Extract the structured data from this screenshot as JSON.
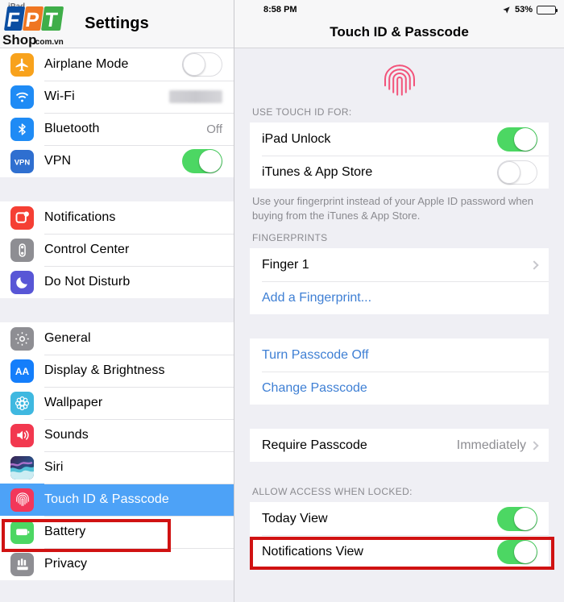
{
  "branding": {
    "logo_text_f": "F",
    "logo_text_p": "P",
    "logo_text_t": "T",
    "logo_shop": "Shop",
    "logo_domain": ".com.vn"
  },
  "sidebar": {
    "title": "Settings",
    "status_left": "iPad",
    "groups": [
      {
        "items": [
          {
            "label": "Airplane Mode",
            "icon": "airplane-icon",
            "icon_color": "#f8a21c",
            "control": "toggle",
            "value": "off"
          },
          {
            "label": "Wi-Fi",
            "icon": "wifi-icon",
            "icon_color": "#1f8bf5",
            "control": "blurred",
            "value": ""
          },
          {
            "label": "Bluetooth",
            "icon": "bluetooth-icon",
            "icon_color": "#1f8bf5",
            "control": "text",
            "value": "Off"
          },
          {
            "label": "VPN",
            "icon": "vpn-icon",
            "icon_color": "#2f6fd0",
            "control": "toggle",
            "value": "on"
          }
        ]
      },
      {
        "items": [
          {
            "label": "Notifications",
            "icon": "notifications-icon",
            "icon_color": "#f53f34",
            "control": "none",
            "value": ""
          },
          {
            "label": "Control Center",
            "icon": "control-center-icon",
            "icon_color": "#8e8e93",
            "control": "none",
            "value": ""
          },
          {
            "label": "Do Not Disturb",
            "icon": "do-not-disturb-icon",
            "icon_color": "#5856d6",
            "control": "none",
            "value": ""
          }
        ]
      },
      {
        "items": [
          {
            "label": "General",
            "icon": "gear-icon",
            "icon_color": "#8e8e93",
            "control": "none",
            "value": ""
          },
          {
            "label": "Display & Brightness",
            "icon": "display-brightness-icon",
            "icon_color": "#147efb",
            "control": "none",
            "value": ""
          },
          {
            "label": "Wallpaper",
            "icon": "wallpaper-icon",
            "icon_color": "#3fb8e0",
            "control": "none",
            "value": ""
          },
          {
            "label": "Sounds",
            "icon": "sounds-icon",
            "icon_color": "#f2384f",
            "control": "none",
            "value": ""
          },
          {
            "label": "Siri",
            "icon": "siri-icon",
            "icon_color": "#2b2b45",
            "control": "none",
            "value": ""
          },
          {
            "label": "Touch ID & Passcode",
            "icon": "touch-id-icon",
            "icon_color": "#f2375a",
            "control": "none",
            "value": "",
            "selected": true
          },
          {
            "label": "Battery",
            "icon": "battery-icon",
            "icon_color": "#4cd763",
            "control": "none",
            "value": ""
          },
          {
            "label": "Privacy",
            "icon": "privacy-icon",
            "icon_color": "#8e8e93",
            "control": "none",
            "value": ""
          }
        ]
      }
    ]
  },
  "detail": {
    "status": {
      "time": "8:58 PM",
      "battery_percent": "53%",
      "location_icon": "location-arrow-icon"
    },
    "title": "Touch ID & Passcode",
    "hero_icon": "fingerprint-icon",
    "section_use_touch_id": {
      "header": "USE TOUCH ID FOR:",
      "rows": [
        {
          "label": "iPad Unlock",
          "toggle": "on"
        },
        {
          "label": "iTunes & App Store",
          "toggle": "off"
        }
      ],
      "footnote": "Use your fingerprint instead of your Apple ID password when buying from the iTunes & App Store."
    },
    "section_fingerprints": {
      "header": "FINGERPRINTS",
      "rows": [
        {
          "label": "Finger 1",
          "type": "disclosure"
        },
        {
          "label": "Add a Fingerprint...",
          "type": "link"
        }
      ]
    },
    "section_passcode": {
      "rows": [
        {
          "label": "Turn Passcode Off",
          "type": "link"
        },
        {
          "label": "Change Passcode",
          "type": "link"
        }
      ]
    },
    "section_require": {
      "rows": [
        {
          "label": "Require Passcode",
          "value": "Immediately",
          "type": "disclosure"
        }
      ]
    },
    "section_allow_access": {
      "header": "ALLOW ACCESS WHEN LOCKED:",
      "rows": [
        {
          "label": "Today View",
          "toggle": "on"
        },
        {
          "label": "Notifications View",
          "toggle": "on"
        }
      ]
    }
  },
  "annotations": {
    "color": "#d01212",
    "boxes": [
      {
        "name": "touch-id-passcode-highlight"
      },
      {
        "name": "today-view-highlight"
      }
    ]
  }
}
